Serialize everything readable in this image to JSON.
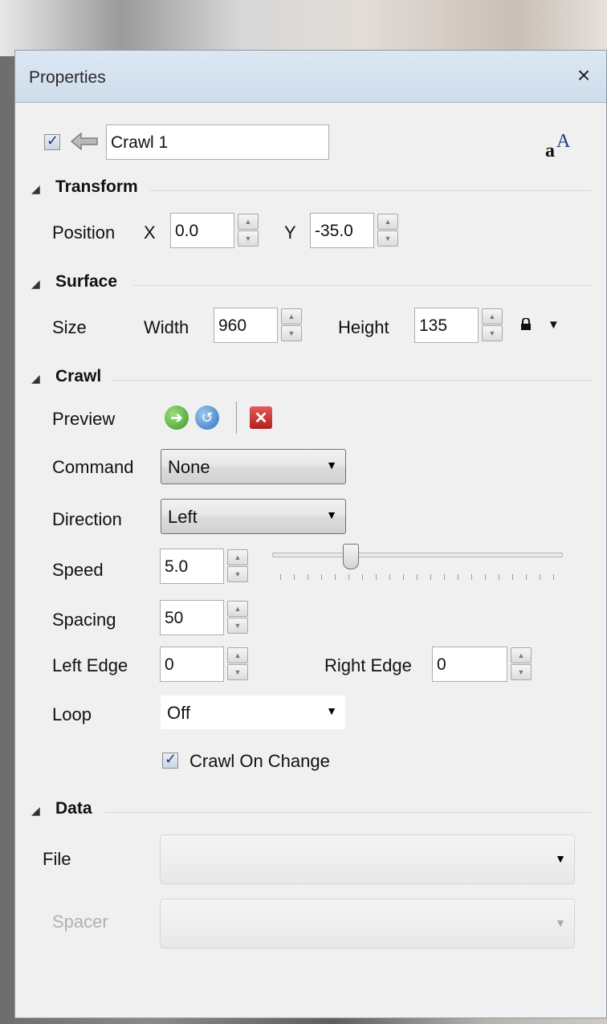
{
  "panel": {
    "title": "Properties",
    "close_glyph": "×"
  },
  "header": {
    "name_value": "Crawl 1",
    "visible_checked": true,
    "font_icon_text": "aA"
  },
  "transform": {
    "section": "Transform",
    "position_label": "Position",
    "x_label": "X",
    "x_value": "0.0",
    "y_label": "Y",
    "y_value": "-35.0"
  },
  "surface": {
    "section": "Surface",
    "size_label": "Size",
    "width_label": "Width",
    "width_value": "960",
    "height_label": "Height",
    "height_value": "135"
  },
  "crawl": {
    "section": "Crawl",
    "preview_label": "Preview",
    "command_label": "Command",
    "command_value": "None",
    "direction_label": "Direction",
    "direction_value": "Left",
    "speed_label": "Speed",
    "speed_value": "5.0",
    "speed_slider_fraction": 0.26,
    "spacing_label": "Spacing",
    "spacing_value": "50",
    "left_edge_label": "Left Edge",
    "left_edge_value": "0",
    "right_edge_label": "Right Edge",
    "right_edge_value": "0",
    "loop_label": "Loop",
    "loop_value": "Off",
    "crawl_on_change_label": "Crawl On Change",
    "crawl_on_change_checked": true
  },
  "data": {
    "section": "Data",
    "file_label": "File",
    "file_value": "",
    "spacer_label": "Spacer",
    "spacer_value": ""
  },
  "icons": {
    "back": "back-arrow-icon",
    "font": "font-icon",
    "lock": "lock-icon",
    "play": "play-icon",
    "reset": "reset-icon",
    "stop": "stop-icon",
    "dropdown": "chevron-down-icon",
    "collapse": "collapse-triangle-icon"
  },
  "colors": {
    "titlebar": "#dce7f3",
    "panel_bg": "#f0f0f0",
    "go": "#3c9b2b",
    "reset": "#2e76bf",
    "stop": "#b11f1f"
  }
}
